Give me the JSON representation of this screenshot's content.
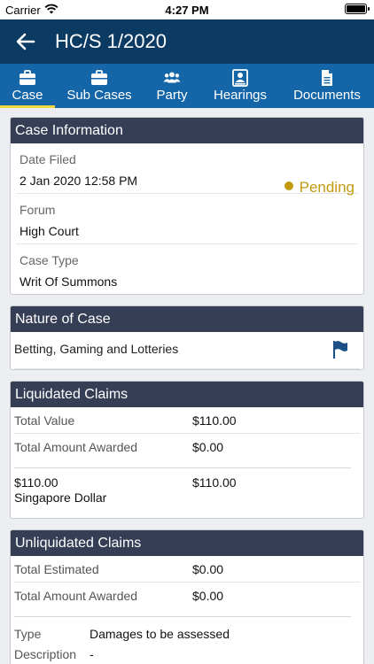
{
  "status_bar": {
    "carrier": "Carrier",
    "time": "4:27 PM"
  },
  "nav": {
    "title": "HC/S 1/2020",
    "back_icon": "back-arrow-icon"
  },
  "tabs": [
    {
      "label": "Case",
      "icon": "briefcase-icon",
      "active": true
    },
    {
      "label": "Sub Cases",
      "icon": "briefcase-icon",
      "active": false
    },
    {
      "label": "Party",
      "icon": "users-icon",
      "active": false
    },
    {
      "label": "Hearings",
      "icon": "judge-icon",
      "active": false
    },
    {
      "label": "Documents",
      "icon": "document-icon",
      "active": false
    }
  ],
  "case_info": {
    "header": "Case Information",
    "date_filed_label": "Date Filed",
    "date_filed_value": "2 Jan 2020 12:58 PM",
    "status": "Pending",
    "forum_label": "Forum",
    "forum_value": "High Court",
    "case_type_label": "Case Type",
    "case_type_value": "Writ Of Summons"
  },
  "nature": {
    "header": "Nature of Case",
    "value": "Betting, Gaming and Lotteries"
  },
  "liquidated": {
    "header": "Liquidated Claims",
    "total_value_label": "Total Value",
    "total_value": "$110.00",
    "awarded_label": "Total Amount Awarded",
    "awarded_value": "$0.00",
    "item_amount": "$110.00",
    "item_currency": "Singapore Dollar",
    "item_value": "$110.00"
  },
  "unliquidated": {
    "header": "Unliquidated Claims",
    "estimated_label": "Total Estimated",
    "estimated_value": "$0.00",
    "awarded_label": "Total Amount Awarded",
    "awarded_value": "$0.00",
    "type_label": "Type",
    "type_value": "Damages to be assessed",
    "description_label": "Description",
    "description_value": "-"
  },
  "colors": {
    "nav_bg": "#0b3a63",
    "tab_bg": "#1466a8",
    "tab_active_indicator": "#f2d93b",
    "card_header_bg": "#363e56",
    "status_pending": "#c29a0f"
  }
}
